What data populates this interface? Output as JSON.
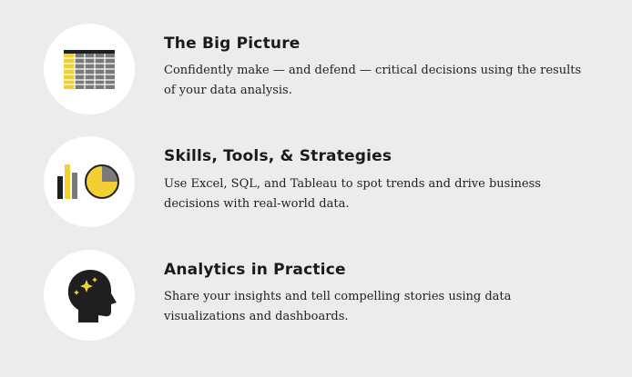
{
  "colors": {
    "background": "#ececec",
    "accent_yellow": "#f2d033",
    "icon_dark": "#1f1f1f",
    "icon_gray": "#7a7a7a"
  },
  "features": [
    {
      "icon": "spreadsheet-icon",
      "title": "The Big Picture",
      "description": "Confidently make — and defend — critical decisions using the results of your data analysis."
    },
    {
      "icon": "charts-icon",
      "title": "Skills, Tools, & Strategies",
      "description": "Use Excel, SQL, and Tableau to spot trends and drive business decisions with real-world data."
    },
    {
      "icon": "head-insight-icon",
      "title": "Analytics in Practice",
      "description": "Share your insights and tell compelling stories using data visualizations and dashboards."
    }
  ]
}
